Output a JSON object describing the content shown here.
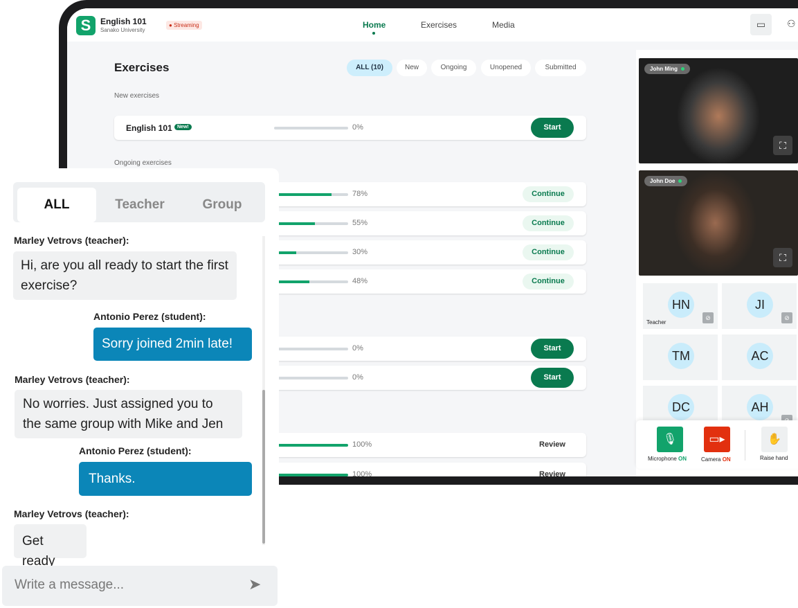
{
  "header": {
    "course": "English 101",
    "org": "Sanako University",
    "status": "Streaming",
    "nav": [
      "Home",
      "Exercises",
      "Media"
    ]
  },
  "exercises": {
    "title": "Exercises",
    "filters": [
      "ALL (10)",
      "New",
      "Ongoing",
      "Unopened",
      "Submitted"
    ],
    "sections": {
      "new": "New exercises",
      "ongoing": "Ongoing exercises"
    },
    "new_item": {
      "name": "English 101",
      "badge": "New!",
      "progress": "0%",
      "action": "Start"
    },
    "rows": [
      {
        "progress": 78,
        "label": "78%",
        "action": "Continue"
      },
      {
        "progress": 55,
        "label": "55%",
        "action": "Continue"
      },
      {
        "progress": 30,
        "label": "30%",
        "action": "Continue"
      },
      {
        "progress": 48,
        "label": "48%",
        "action": "Continue"
      },
      {
        "progress": 0,
        "label": "0%",
        "action": "Start"
      },
      {
        "progress": 0,
        "label": "0%",
        "action": "Start"
      },
      {
        "progress": 100,
        "label": "100%",
        "action": "Review"
      },
      {
        "progress": 100,
        "label": "100%",
        "action": "Review"
      }
    ]
  },
  "videos": [
    {
      "name": "John Ming"
    },
    {
      "name": "John Doe"
    }
  ],
  "participants": [
    {
      "initials": "HN",
      "role": "Teacher",
      "muted": true
    },
    {
      "initials": "JI",
      "muted": true
    },
    {
      "initials": "TM"
    },
    {
      "initials": "AC"
    },
    {
      "initials": "DC"
    },
    {
      "initials": "AH",
      "muted": true
    }
  ],
  "controls": {
    "mic": "Microphone",
    "mic_state": "ON",
    "cam": "Camera",
    "cam_state": "ON",
    "hand": "Raise hand"
  },
  "chat": {
    "tabs": [
      "ALL",
      "Teacher",
      "Group"
    ],
    "placeholder": "Write a message...",
    "messages": [
      {
        "from": "Marley Vetrovs (teacher):",
        "text": "Hi, are you all ready to start the first exercise?"
      },
      {
        "from": "Antonio Perez (student):",
        "text": "Sorry joined 2min late!"
      },
      {
        "from": "Marley Vetrovs (teacher):",
        "text": "No worries. Just assigned you to the same group with Mike and Jen"
      },
      {
        "from": "Antonio Perez (student):",
        "text": "Thanks."
      },
      {
        "from": "Marley Vetrovs (teacher):",
        "text": "Get ready"
      }
    ]
  },
  "colors": {
    "brand": "#12a36b",
    "primary": "#0a7a4f",
    "chat_out": "#0b86b8",
    "camera": "#e2300f"
  }
}
